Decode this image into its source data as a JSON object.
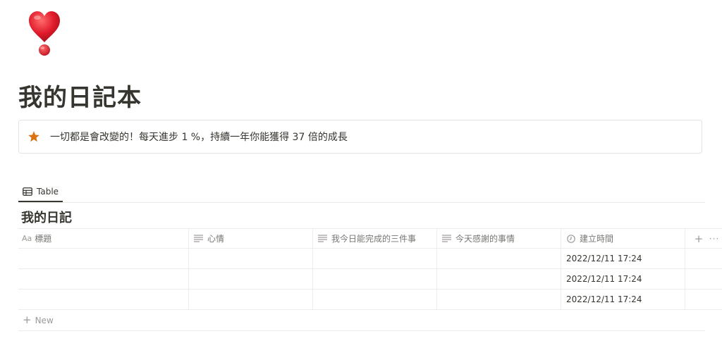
{
  "page": {
    "icon": "heavy-exclamation-mark-heart-icon",
    "title": "我的日記本"
  },
  "callout": {
    "icon": "star-icon",
    "icon_color": "#d9730d",
    "text": "一切都是會改變的！每天進步 1 %，持續一年你能獲得 37 倍的成長"
  },
  "views": {
    "tabs": [
      {
        "icon": "table-icon",
        "label": "Table",
        "active": true
      }
    ]
  },
  "database": {
    "title": "我的日記",
    "columns": [
      {
        "icon": "title-icon",
        "icon_text": "Aa",
        "label": "標題"
      },
      {
        "icon": "text-lines-icon",
        "label": "心情"
      },
      {
        "icon": "text-lines-icon",
        "label": "我今日能完成的三件事"
      },
      {
        "icon": "text-lines-icon",
        "label": "今天感謝的事情"
      },
      {
        "icon": "clock-icon",
        "label": "建立時間"
      }
    ],
    "add_column_glyph": "+",
    "more_glyph": "···",
    "rows": [
      {
        "title": "",
        "mood": "",
        "three_things": "",
        "grateful": "",
        "created": "2022/12/11 17:24"
      },
      {
        "title": "",
        "mood": "",
        "three_things": "",
        "grateful": "",
        "created": "2022/12/11 17:24"
      },
      {
        "title": "",
        "mood": "",
        "three_things": "",
        "grateful": "",
        "created": "2022/12/11 17:24"
      }
    ],
    "new_row": {
      "glyph": "+",
      "label": "New"
    }
  }
}
